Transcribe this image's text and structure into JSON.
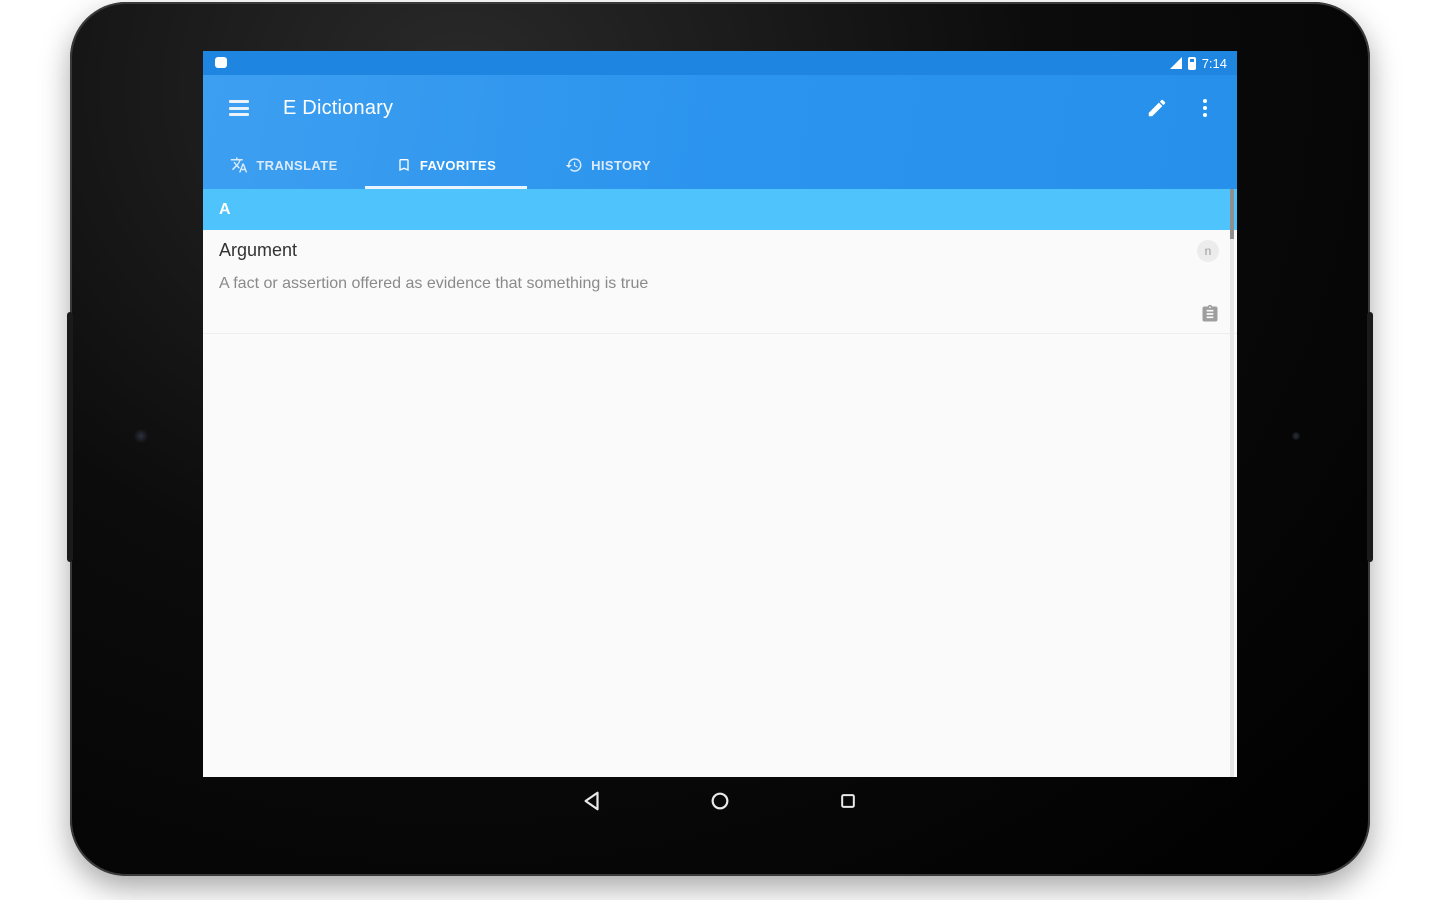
{
  "statusbar": {
    "time": "7:14"
  },
  "appbar": {
    "title": "E Dictionary",
    "colors": {
      "primary": "#2b94ee",
      "status": "#1e86e0",
      "section": "#4fc3fb"
    }
  },
  "tabs": [
    {
      "label": "TRANSLATE",
      "icon": "translate-icon",
      "active": false
    },
    {
      "label": "FAVORITES",
      "icon": "bookmark-icon",
      "active": true
    },
    {
      "label": "HISTORY",
      "icon": "history-icon",
      "active": false
    }
  ],
  "section": {
    "letter": "A"
  },
  "entries": [
    {
      "word": "Argument",
      "definition": "A fact or assertion offered as evidence that something is true",
      "pos": "n",
      "action_icon": "clipboard-icon"
    }
  ],
  "navbar": {
    "back_icon": "back-icon",
    "home_icon": "home-icon",
    "recents_icon": "recents-icon"
  }
}
